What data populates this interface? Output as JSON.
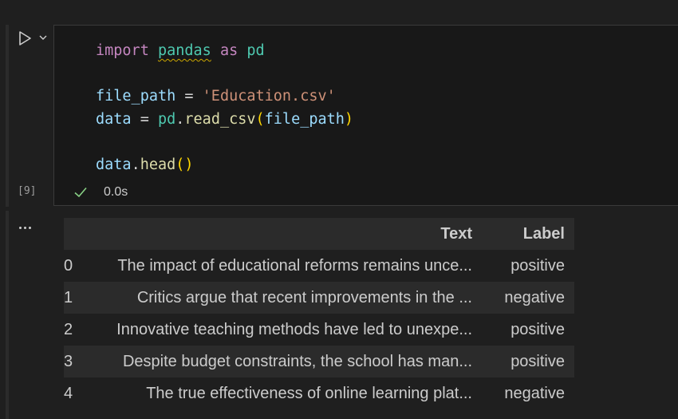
{
  "cell": {
    "execution_count": "[9]",
    "status_time": "0.0s",
    "code": {
      "line1": {
        "kw_import": "import",
        "module": "pandas",
        "kw_as": "as",
        "alias": "pd"
      },
      "line3": {
        "var": "file_path",
        "op": "=",
        "str": "'Education.csv'"
      },
      "line4": {
        "var": "data",
        "op": "=",
        "obj": "pd",
        "dot": ".",
        "fn": "read_csv",
        "lparen": "(",
        "arg": "file_path",
        "rparen": ")"
      },
      "line6": {
        "var": "data",
        "dot": ".",
        "fn": "head",
        "parens": "()"
      }
    }
  },
  "output": {
    "columns": [
      "",
      "Text",
      "Label"
    ],
    "rows": [
      {
        "index": "0",
        "text": "The impact of educational reforms remains unce...",
        "label": "positive"
      },
      {
        "index": "1",
        "text": "Critics argue that recent improvements in the ...",
        "label": "negative"
      },
      {
        "index": "2",
        "text": "Innovative teaching methods have led to unexpe...",
        "label": "positive"
      },
      {
        "index": "3",
        "text": "Despite budget constraints, the school has man...",
        "label": "positive"
      },
      {
        "index": "4",
        "text": "The true effectiveness of online learning plat...",
        "label": "negative"
      }
    ]
  },
  "colors": {
    "background": "#1f1f1f",
    "editor": "#181818",
    "success": "#89d185",
    "table_stripe": "#2b2b2b"
  },
  "icons": {
    "run": "play-icon",
    "dropdown": "chevron-down-icon",
    "status": "check-icon",
    "output_menu": "ellipsis-icon"
  }
}
